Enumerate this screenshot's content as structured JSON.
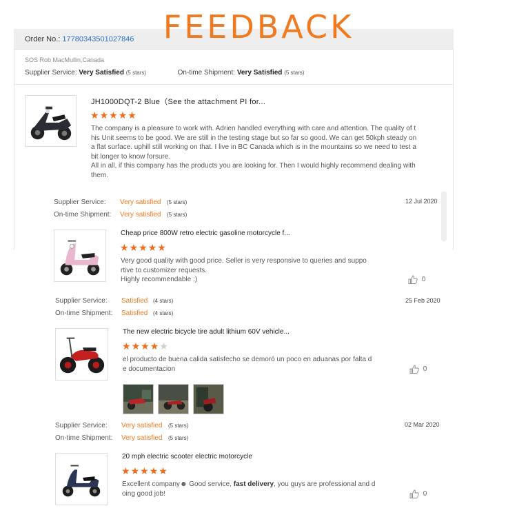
{
  "banner": {
    "title": "FEEDBACK"
  },
  "order": {
    "label": "Order No.:",
    "number": "17780343501027846"
  },
  "buyer": "SOS Rob MacMullin,Canada",
  "order_rating": {
    "supplier_label": "Supplier Service:",
    "supplier_value": "Very Satisfied",
    "supplier_stars": "(5 stars)",
    "shipment_label": "On-time Shipment:",
    "shipment_value": "Very Satisfied",
    "shipment_stars": "(5 stars)"
  },
  "main_review": {
    "title": "JH1000DQT-2 Blue（See the attachment PI for...",
    "rating": 5,
    "text_lines": [
      "The company is a pleasure to work with. Adrien handled everything with care and attention.  The quality of t",
      "his Unit seems to be good. We are still in the testing stage but so far so good. We can get 50kph steady on",
      "a flat surface.  uphill still working on that. I live in BC Canada which is in the mountains so we need to test a",
      "bit longer to know forsure.",
      "All in all, if this company has the products you are looking for. Then I would highly recommend dealing with",
      "them."
    ]
  },
  "reviews": [
    {
      "supplier_label": "Supplier Service:",
      "supplier_value": "Very satisfied",
      "supplier_stars": "(5 stars)",
      "shipment_label": "On-time Shipment:",
      "shipment_value": "Very satisfied",
      "shipment_stars": "(5 stars)",
      "date": "12 Jul 2020",
      "title": "Cheap price 800W retro electric gasoline motorcycle f...",
      "rating": 5,
      "text_lines": [
        "Very good quality with good price.   Seller is very responsive to queries and suppo",
        "rtive to customizer requests.",
        "Highly recommendable :)"
      ],
      "likes": "0"
    },
    {
      "supplier_label": "Supplier Service:",
      "supplier_value": "Satisfied",
      "supplier_stars": "(4 stars)",
      "shipment_label": "On-time Shipment:",
      "shipment_value": "Satisfied",
      "shipment_stars": "(4 stars)",
      "date": "25 Feb 2020",
      "title": "The new electric bicycle tire adult lithium 60V vehicle...",
      "rating": 4,
      "text_lines": [
        "el producto de buena calida satisfecho se demoró un poco en aduanas por falta d",
        "e documentacion"
      ],
      "likes": "0"
    },
    {
      "supplier_label": "Supplier Service:",
      "supplier_value": "Very satisfied",
      "supplier_stars": "(5 stars)",
      "shipment_label": "On-time Shipment:",
      "shipment_value": "Very satisfied",
      "shipment_stars": "(5 stars)",
      "date": "02 Mar 2020",
      "title": "20 mph electric scooter electric motorcycle",
      "rating": 5,
      "text_pre": "Excellent company",
      "text_mid1": " Good service, ",
      "text_bold": "fast delivery",
      "text_mid2": ", you guys are professional and d",
      "text_line2": "oing good job!",
      "likes": "0"
    }
  ],
  "colors": {
    "accent": "#f07a1f",
    "star": "#f26b1d",
    "link": "#2e73c2"
  },
  "icons": [
    "thumbs-up-icon",
    "star-icon",
    "emoji-icon"
  ]
}
